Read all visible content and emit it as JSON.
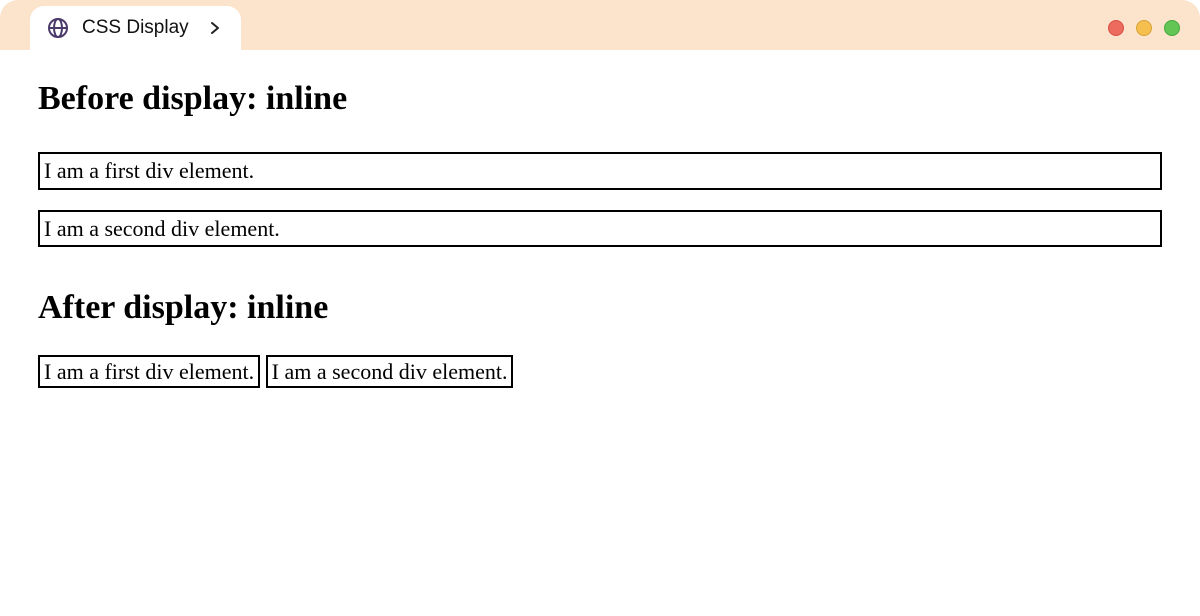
{
  "browser": {
    "tab_title": "CSS Display"
  },
  "content": {
    "heading_before": "Before display: inline",
    "heading_after": "After display: inline",
    "first_div_text": "I am a first div element.",
    "second_div_text": "I am a second div element."
  }
}
